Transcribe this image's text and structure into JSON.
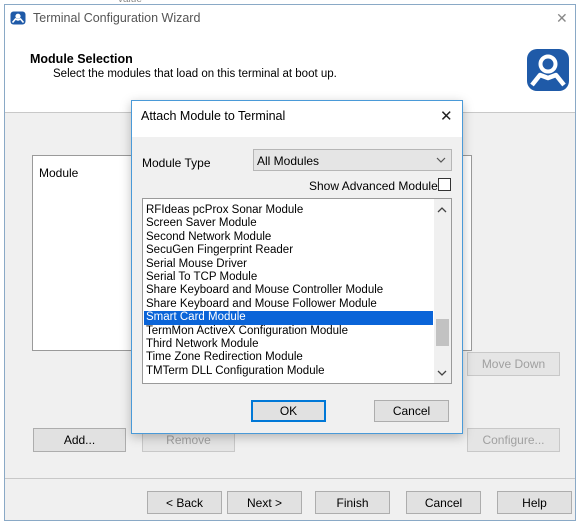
{
  "top_cut_text": "value",
  "wizard": {
    "title": "Terminal Configuration Wizard",
    "close_glyph": "✕",
    "header_title": "Module Selection",
    "header_subtitle": "Select the modules that load on this terminal at boot up.",
    "list_header": "Module",
    "buttons": {
      "add": "Add...",
      "remove": "Remove",
      "move_down": "Move Down",
      "configure": "Configure...",
      "back": "< Back",
      "next": "Next >",
      "finish": "Finish",
      "cancel": "Cancel",
      "help": "Help"
    }
  },
  "dialog": {
    "title": "Attach Module to Terminal",
    "close_glyph": "✕",
    "module_type_label": "Module Type",
    "module_type_value": "All Modules",
    "show_advanced_label": "Show Advanced Modules",
    "show_advanced_checked": false,
    "modules": [
      "RFIdeas pcProx Sonar Module",
      "Screen Saver Module",
      "Second Network Module",
      "SecuGen Fingerprint Reader",
      "Serial Mouse Driver",
      "Serial To TCP Module",
      "Share Keyboard and Mouse Controller Module",
      "Share Keyboard and Mouse Follower Module",
      "Smart Card Module",
      "TermMon ActiveX Configuration Module",
      "Third Network Module",
      "Time Zone Redirection Module",
      "TMTerm DLL Configuration Module"
    ],
    "selected_index": 8,
    "ok_label": "OK",
    "cancel_label": "Cancel"
  },
  "colors": {
    "selection": "#0a64d8",
    "dialog_border": "#4a9ad8",
    "focus_border": "#0078d7",
    "header_band": "#ffffff",
    "body_band": "#f0f0f0"
  }
}
